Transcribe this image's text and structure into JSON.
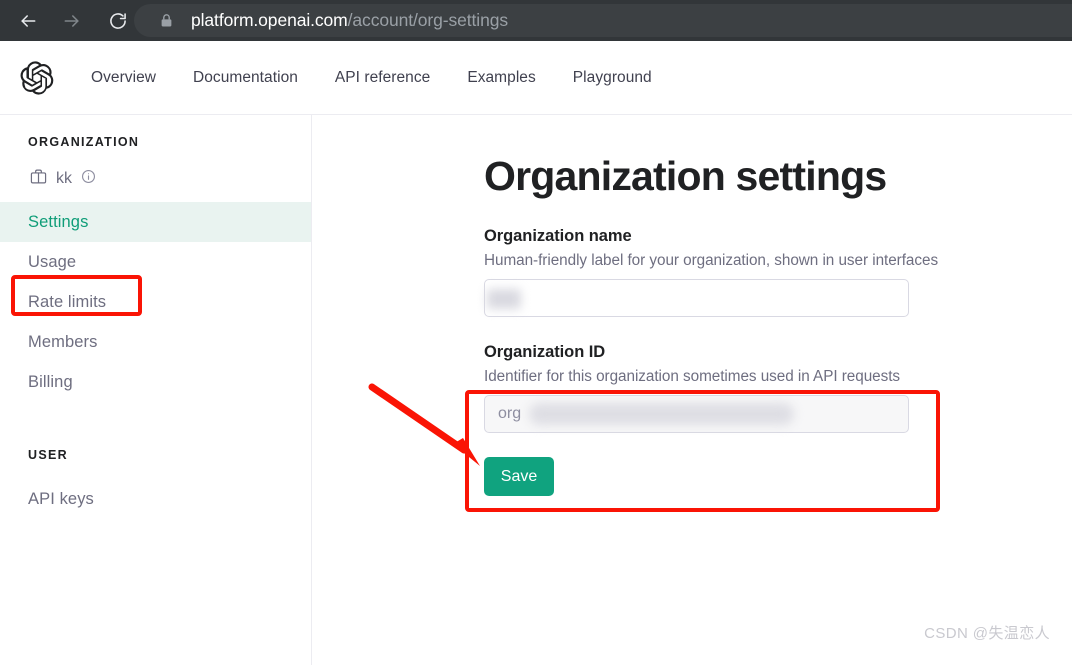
{
  "browser": {
    "back_icon": "arrow-left-icon",
    "forward_icon": "arrow-right-icon",
    "reload_icon": "reload-icon",
    "lock_icon": "lock-icon",
    "url_domain": "platform.openai.com",
    "url_path": "/account/org-settings"
  },
  "header": {
    "logo_icon": "openai-logo-icon",
    "nav": [
      {
        "label": "Overview"
      },
      {
        "label": "Documentation"
      },
      {
        "label": "API reference"
      },
      {
        "label": "Examples"
      },
      {
        "label": "Playground"
      }
    ]
  },
  "sidebar": {
    "org_heading": "ORGANIZATION",
    "org_chip": {
      "building_icon": "building-icon",
      "name": "kk",
      "info_icon": "info-circle-icon"
    },
    "org_items": [
      {
        "label": "Settings",
        "active": true
      },
      {
        "label": "Usage",
        "active": false
      },
      {
        "label": "Rate limits",
        "active": false
      },
      {
        "label": "Members",
        "active": false
      },
      {
        "label": "Billing",
        "active": false
      }
    ],
    "user_heading": "USER",
    "user_items": [
      {
        "label": "API keys",
        "active": false
      }
    ]
  },
  "main": {
    "title": "Organization settings",
    "org_name": {
      "label": "Organization name",
      "help": "Human-friendly label for your organization, shown in user interfaces",
      "value": "",
      "redacted": true
    },
    "org_id": {
      "label": "Organization ID",
      "help": "Identifier for this organization sometimes used in API requests",
      "value": "org",
      "redacted": true
    },
    "save_label": "Save"
  },
  "annotations": {
    "color": "#fa1405",
    "settings_highlight": "red-rectangle-settings",
    "org_id_highlight": "red-rectangle-org-id",
    "arrow": "red-arrow-pointing-to-org-id"
  },
  "watermark": "CSDN @失温恋人",
  "colors": {
    "accent_green": "#10a37f",
    "active_nav_green": "#0f9d78",
    "active_row_bg": "#e9f3f0",
    "annotation_red": "#fa1405",
    "chrome_bg": "#323639",
    "omnibox_bg": "#3c4043"
  }
}
